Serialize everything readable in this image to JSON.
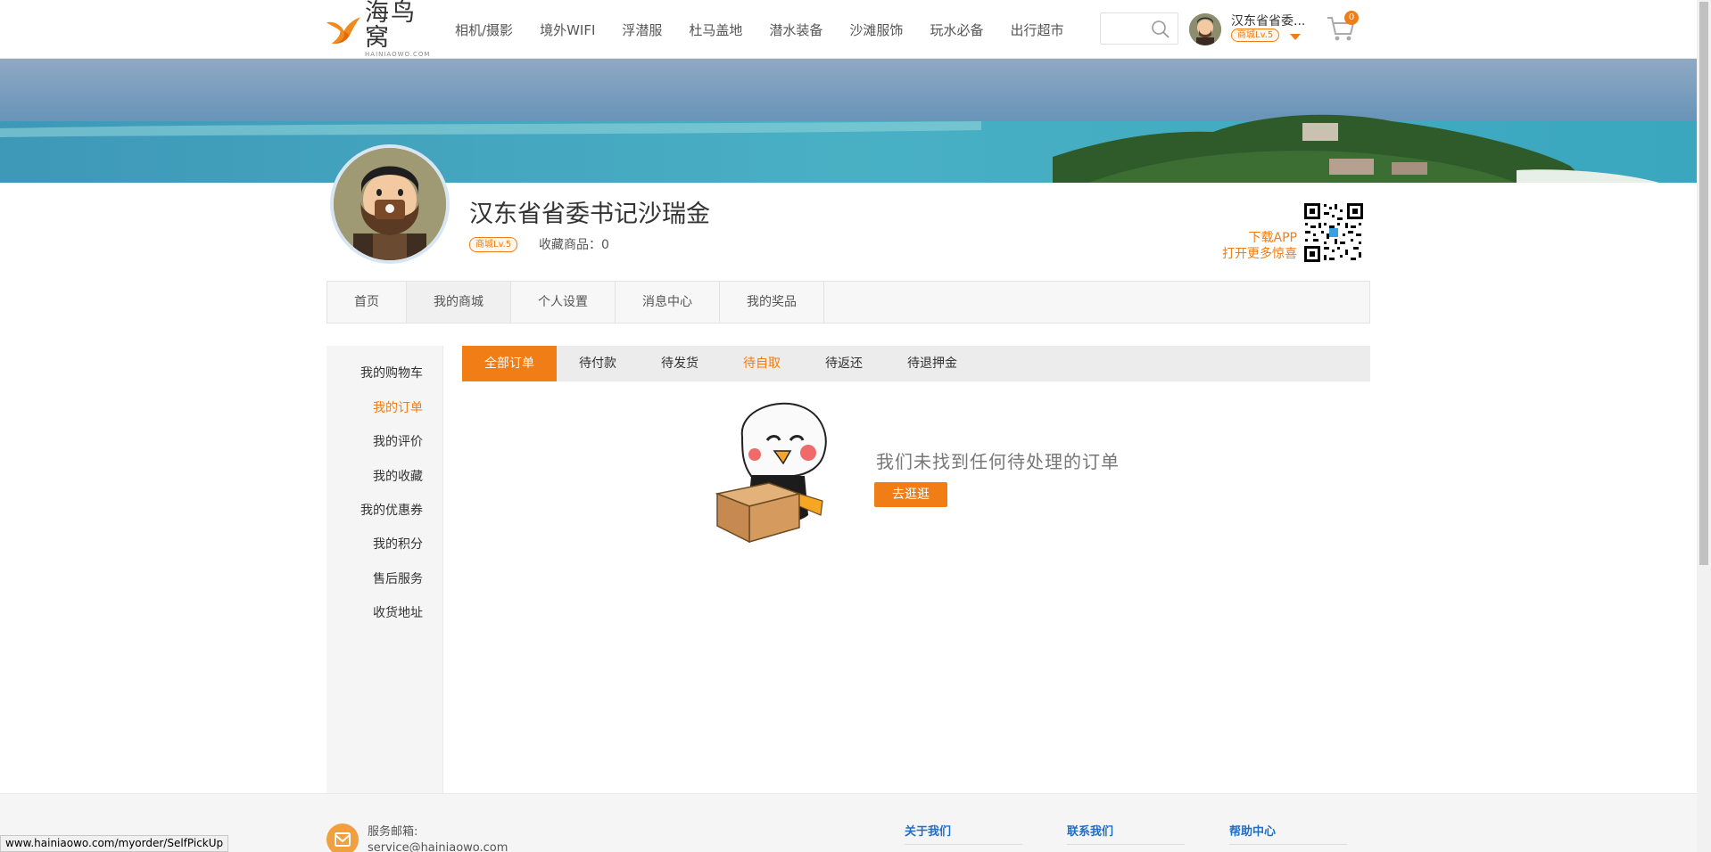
{
  "header": {
    "logo_cn": "海鸟窝",
    "logo_en": "HAINIAOWO.COM",
    "nav": [
      "相机/摄影",
      "境外WIFI",
      "浮潜服",
      "杜马盖地",
      "潜水装备",
      "沙滩服饰",
      "玩水必备",
      "出行超市"
    ],
    "user_name": "汉东省省委...",
    "user_level": "商城Lv.5",
    "cart_count": "0"
  },
  "profile": {
    "name": "汉东省省委书记沙瑞金",
    "level": "商城Lv.5",
    "favorites": "收藏商品：0",
    "app_line1": "下载APP",
    "app_line2": "打开更多惊喜"
  },
  "profile_tabs": [
    "首页",
    "我的商城",
    "个人设置",
    "消息中心",
    "我的奖品"
  ],
  "sidebar": [
    "我的购物车",
    "我的订单",
    "我的评价",
    "我的收藏",
    "我的优惠券",
    "我的积分",
    "售后服务",
    "收货地址"
  ],
  "order_tabs": [
    "全部订单",
    "待付款",
    "待发货",
    "待自取",
    "待返还",
    "待退押金"
  ],
  "empty": {
    "message": "我们未找到任何待处理的订单",
    "button": "去逛逛"
  },
  "footer": {
    "mail_label": "服务邮箱:",
    "mail_address": "service@hainiaowo.com",
    "col1": "关于我们",
    "col2": "联系我们",
    "col3": "帮助中心"
  },
  "status_url": "www.hainiaowo.com/myorder/SelfPickUp",
  "colors": {
    "accent": "#f07d16",
    "link": "#1f6fc7"
  }
}
